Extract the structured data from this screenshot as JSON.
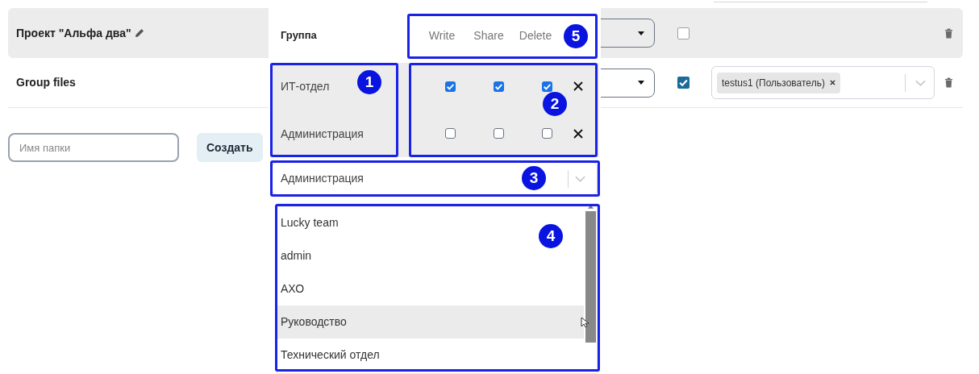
{
  "rows": [
    {
      "title": "Проект \"Альфа два\"",
      "editable": true,
      "highlighted": true,
      "checked": false,
      "tags": []
    },
    {
      "title": "Group files",
      "editable": false,
      "highlighted": false,
      "checked": true,
      "tags": [
        {
          "label": "testus1 (Пользователь)"
        }
      ]
    }
  ],
  "new_folder": {
    "placeholder": "Имя папки",
    "button": "Создать"
  },
  "permissions": {
    "group_header": "Группа",
    "columns": [
      "Write",
      "Share",
      "Delete"
    ],
    "groups": [
      {
        "name": "ИТ-отдел",
        "write": true,
        "share": true,
        "delete": true
      },
      {
        "name": "Администрация",
        "write": false,
        "share": false,
        "delete": false
      }
    ],
    "add_group": {
      "value": "Администрация"
    },
    "options": [
      {
        "label": "Lucky team",
        "highlighted": false
      },
      {
        "label": "admin",
        "highlighted": false
      },
      {
        "label": "АХО",
        "highlighted": false
      },
      {
        "label": "Руководство",
        "highlighted": true
      },
      {
        "label": "Технический отдел",
        "highlighted": false
      }
    ]
  },
  "callouts": [
    {
      "number": "1"
    },
    {
      "number": "2"
    },
    {
      "number": "3"
    },
    {
      "number": "4"
    },
    {
      "number": "5"
    }
  ]
}
